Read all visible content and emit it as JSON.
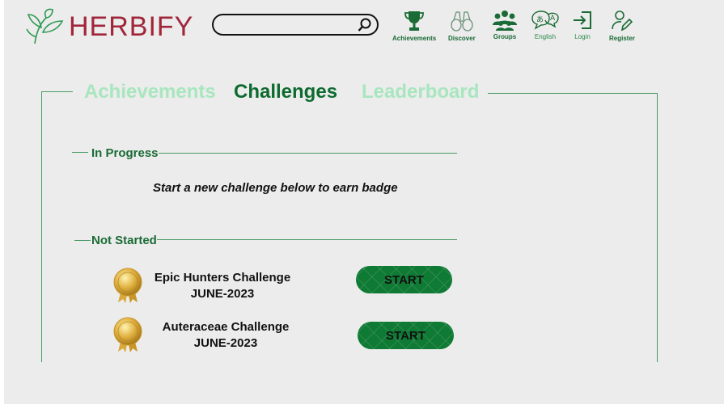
{
  "brand": {
    "name": "HERBIFY",
    "color": "#a0263a"
  },
  "search": {
    "placeholder": "",
    "value": ""
  },
  "nav": {
    "achievements": "Achievements",
    "discover": "Discover",
    "groups": "Groups",
    "english": "English",
    "login": "Login",
    "register": "Register"
  },
  "tabs": [
    {
      "label": "Achievements",
      "active": false
    },
    {
      "label": "Challenges",
      "active": true
    },
    {
      "label": "Leaderboard",
      "active": false
    }
  ],
  "sections": {
    "in_progress": {
      "title": "In Progress",
      "message": "Start a new challenge below to earn badge"
    },
    "not_started": {
      "title": "Not Started"
    }
  },
  "challenges": [
    {
      "name": "Epic Hunters Challenge",
      "date": "JUNE-2023",
      "button": "START",
      "icon": "medal-icon"
    },
    {
      "name": "Auteraceae Challenge",
      "date": "JUNE-2023",
      "button": "START",
      "icon": "medal-icon"
    }
  ],
  "colors": {
    "accent": "#0e7a34",
    "inactive_tab": "#a8e6bf",
    "background": "#ececec"
  }
}
